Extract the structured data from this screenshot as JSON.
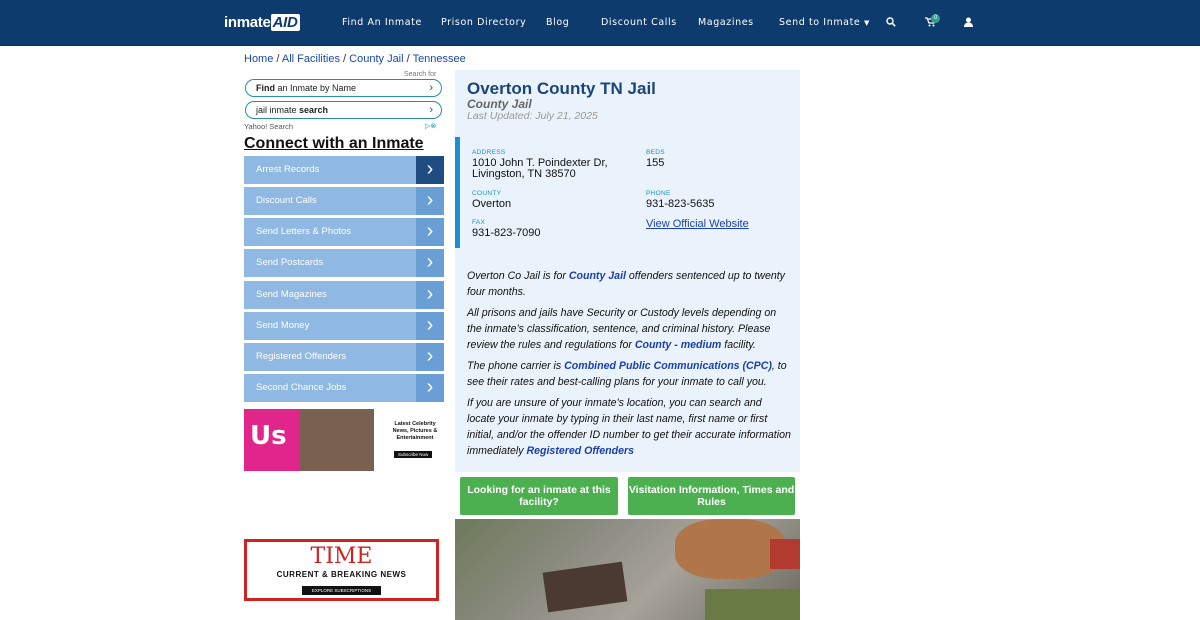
{
  "nav": {
    "logo_a": "inmate",
    "logo_b": "AID",
    "links": [
      "Find An Inmate",
      "Prison Directory",
      "Blog",
      "Discount Calls",
      "Magazines",
      "Send to Inmate"
    ],
    "cart_count": "0"
  },
  "breadcrumb": [
    "Home",
    "All Facilities",
    "County Jail",
    "Tennessee"
  ],
  "search": {
    "caption": "Search for",
    "item1_bold": "Find",
    "item1_rest": " an Inmate by Name",
    "item2_rest": "jail inmate ",
    "item2_bold": "search",
    "provider": "Yahoo! Search"
  },
  "sidebar": {
    "heading": "Connect with an Inmate",
    "items": [
      "Arrest Records",
      "Discount Calls",
      "Send Letters & Photos",
      "Send Postcards",
      "Send Magazines",
      "Send Money",
      "Registered Offenders",
      "Second Chance Jobs"
    ]
  },
  "ads": {
    "us_logo": "Us",
    "us_text": "Latest Celebrity News, Pictures & Entertainment",
    "us_button": "Subscribe Now",
    "time_logo": "TIME",
    "time_text": "CURRENT & BREAKING NEWS",
    "time_button": "EXPLORE SUBSCRIPTIONS"
  },
  "facility": {
    "title": "Overton County TN Jail",
    "type": "County Jail",
    "updated": "Last Updated: July 21, 2025",
    "address_label": "ADDRESS",
    "address_line1": "1010 John T. Poindexter Dr,",
    "address_line2": "Livingston, TN 38570",
    "beds_label": "BEDS",
    "beds": "155",
    "county_label": "COUNTY",
    "county": "Overton",
    "phone_label": "PHONE",
    "phone": "931-823-5635",
    "fax_label": "FAX",
    "fax": "931-823-7090",
    "website": "View Official Website"
  },
  "description": {
    "p1_a": "Overton Co Jail is for ",
    "p1_link": "County Jail",
    "p1_b": " offenders sentenced up to twenty four months.",
    "p2_a": "All prisons and jails have Security or Custody levels depending on the inmate’s classification, sentence, and criminal history. Please review the rules and regulations for ",
    "p2_link": "County - medium",
    "p2_b": " facility.",
    "p3_a": "The phone carrier is ",
    "p3_link": "Combined Public Communications (CPC)",
    "p3_b": ", to see their rates and best-calling plans for your inmate to call you.",
    "p4_a": "If you are unsure of your inmate's location, you can search and locate your inmate by typing in their last name, first name or first initial, and/or the offender ID number to get their accurate information immediately ",
    "p4_link": "Registered Offenders"
  },
  "buttons": {
    "find": "Looking for an inmate at this facility?",
    "visit": "Visitation Information, Times and Rules"
  }
}
